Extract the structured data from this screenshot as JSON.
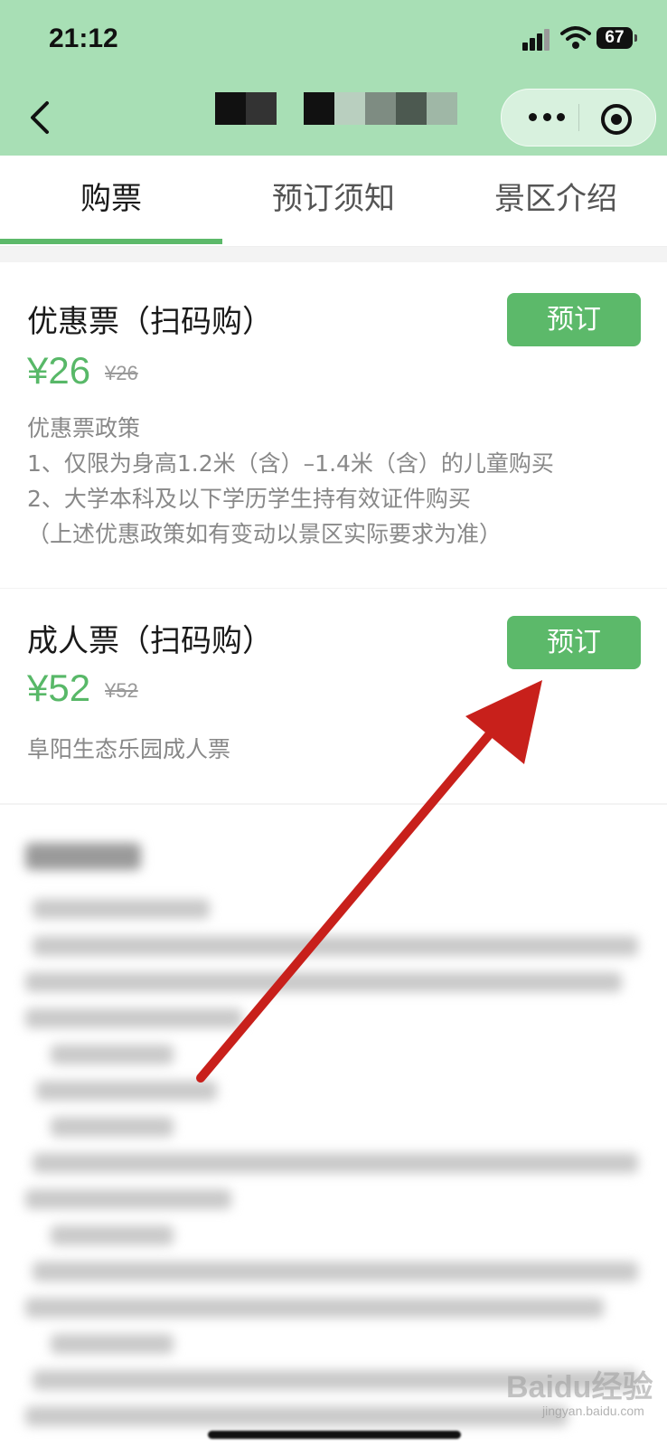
{
  "status_bar": {
    "time": "21:12",
    "battery": "67"
  },
  "header": {
    "back_icon": "chevron-left-icon",
    "more_icon": "more-dots-icon",
    "close_icon": "target-circle-icon"
  },
  "tabs": [
    {
      "label": "购票",
      "active": true
    },
    {
      "label": "预订须知",
      "active": false
    },
    {
      "label": "景区介绍",
      "active": false
    }
  ],
  "tickets": [
    {
      "title": "优惠票（扫码购）",
      "price": "¥26",
      "original_price": "¥26",
      "book_label": "预订",
      "description": [
        "优惠票政策",
        "1、仅限为身高1.2米（含）–1.4米（含）的儿童购买",
        "2、大学本科及以下学历学生持有效证件购买",
        "（上述优惠政策如有变动以景区实际要求为准）"
      ]
    },
    {
      "title": "成人票（扫码购）",
      "price": "¥52",
      "original_price": "¥52",
      "book_label": "预订",
      "description": [
        "阜阳生态乐园成人票"
      ]
    }
  ],
  "watermark": {
    "brand": "Baidu经验",
    "url": "jingyan.baidu.com"
  },
  "colors": {
    "accent_green": "#5cb96a",
    "header_green": "#a8dfb5",
    "arrow_red": "#c8201b"
  }
}
